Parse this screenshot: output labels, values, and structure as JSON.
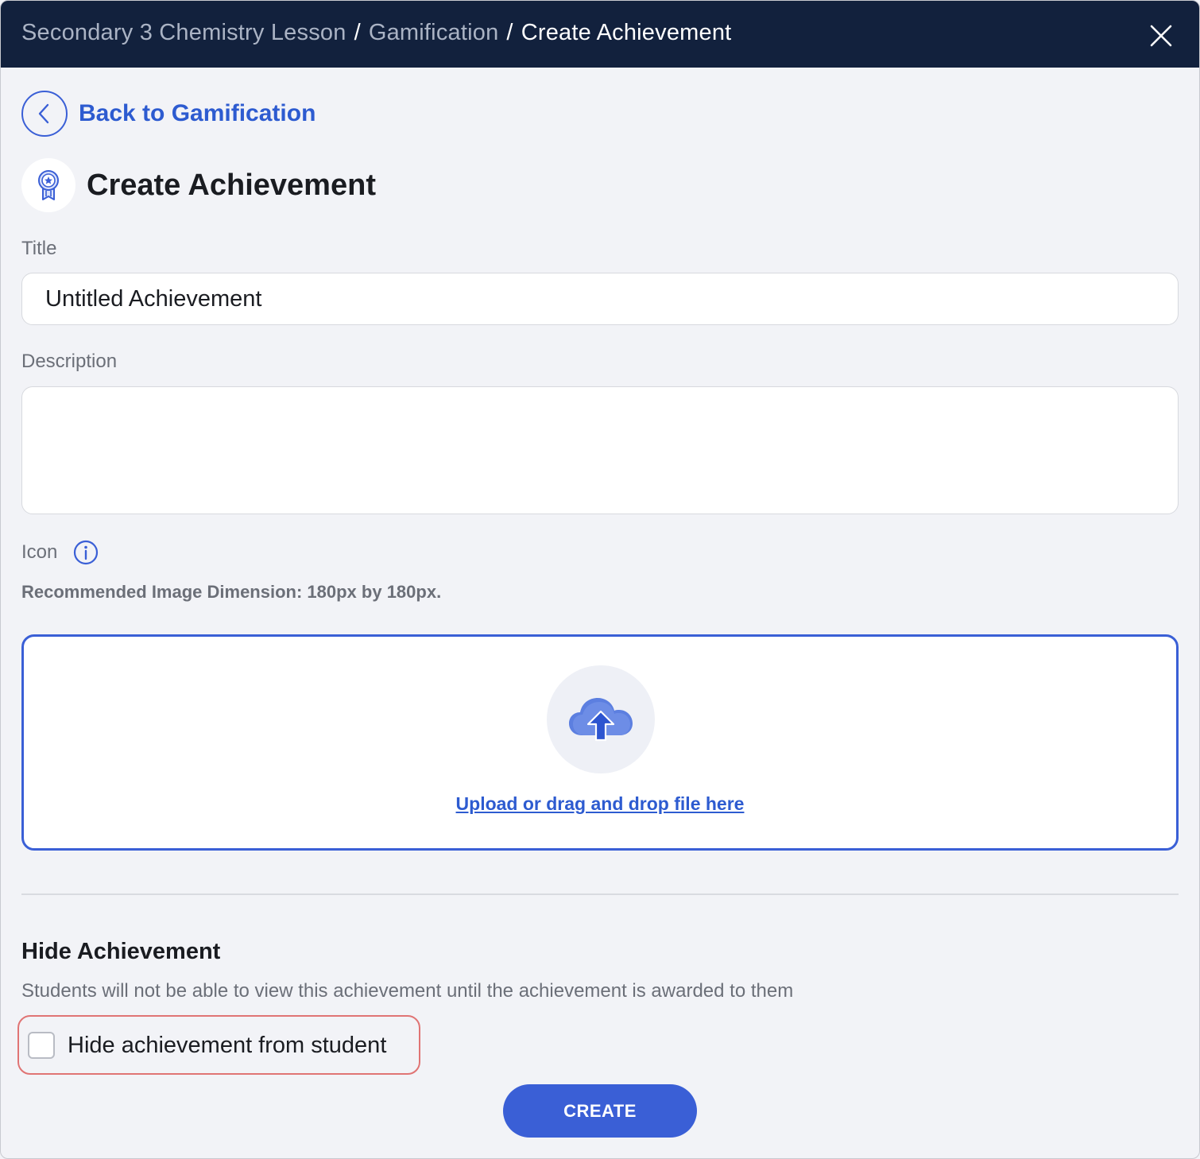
{
  "header": {
    "breadcrumb": [
      "Secondary 3 Chemistry Lesson",
      "Gamification",
      "Create Achievement"
    ],
    "separator": "/",
    "close_icon": "close-icon"
  },
  "back": {
    "label": "Back to Gamification",
    "icon": "chevron-left-icon"
  },
  "page": {
    "title": "Create Achievement",
    "icon": "achievement-badge-icon"
  },
  "form": {
    "title_label": "Title",
    "title_value": "Untitled Achievement",
    "description_label": "Description",
    "description_value": "",
    "icon_label": "Icon",
    "icon_info_icon": "info-icon",
    "dimension_note": "Recommended Image Dimension: 180px by 180px.",
    "upload_icon": "cloud-upload-icon",
    "upload_text": "Upload or drag and drop file here"
  },
  "hide_section": {
    "title": "Hide Achievement",
    "description": "Students will not be able to view this achievement until the achievement is awarded to them",
    "checkbox_label": "Hide achievement from student",
    "checked": false
  },
  "actions": {
    "create_label": "CREATE"
  },
  "colors": {
    "header_bg": "#12213d",
    "accent": "#3a5fd6",
    "link": "#2d5bd0",
    "page_bg": "#f2f3f7",
    "highlight": "#e07474"
  }
}
